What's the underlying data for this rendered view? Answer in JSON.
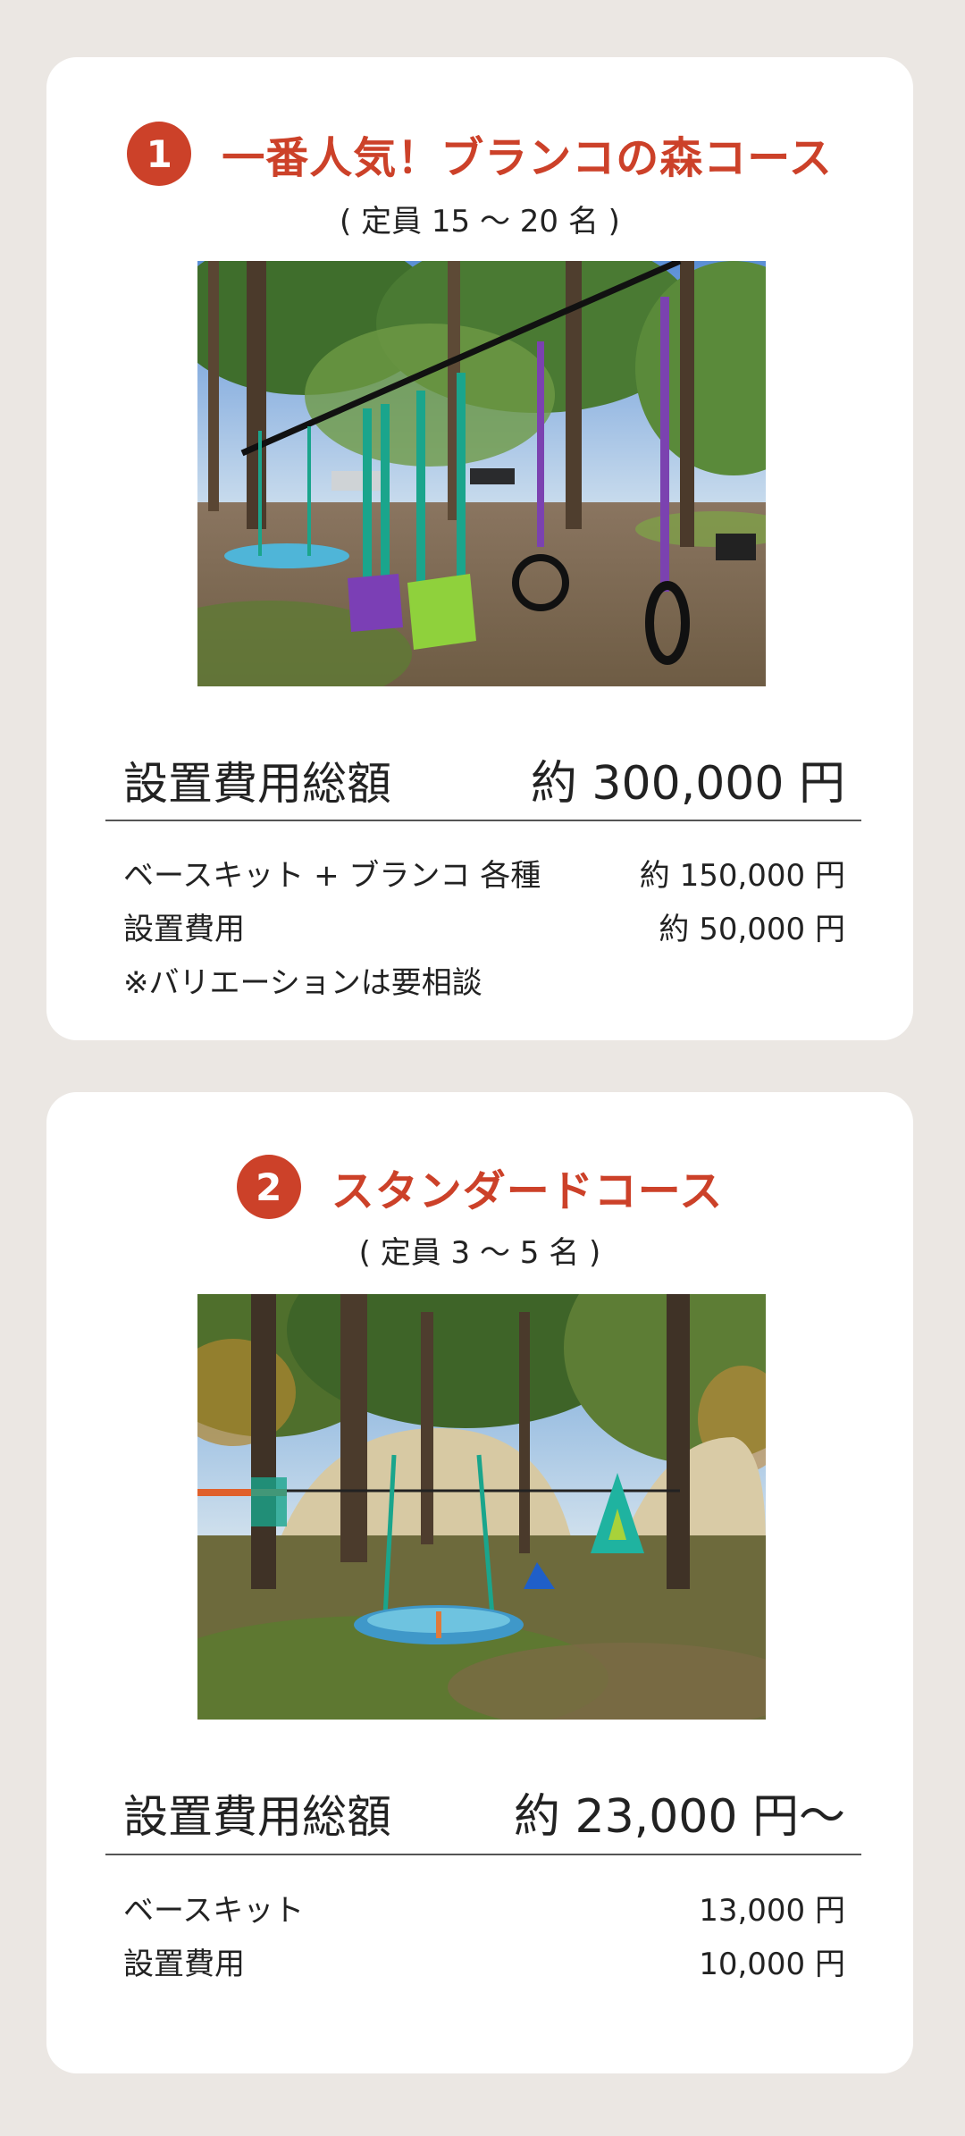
{
  "courses": [
    {
      "number": "1",
      "title": "一番人気！ブランコの森コース",
      "capacity": "( 定員 15 〜 20 名 )",
      "photo_icon": "forest-swings-photo",
      "total_label": "設置費用総額",
      "total_value": "約 300,000 円",
      "items": [
        {
          "label": "ベースキット + ブランコ 各種",
          "value": "約 150,000 円"
        },
        {
          "label": "設置費用",
          "value": "約 50,000 円"
        }
      ],
      "note": "※バリエーションは要相談"
    },
    {
      "number": "2",
      "title": "スタンダードコース",
      "capacity": "( 定員 3 〜 5 名 )",
      "photo_icon": "standard-swing-photo",
      "total_label": "設置費用総額",
      "total_value": "約 23,000 円〜",
      "items": [
        {
          "label": "ベースキット",
          "value": "13,000 円"
        },
        {
          "label": "設置費用",
          "value": "10,000 円"
        }
      ]
    }
  ],
  "colors": {
    "accent": "#cc4129",
    "background": "#ebe7e3",
    "card": "#ffffff"
  }
}
